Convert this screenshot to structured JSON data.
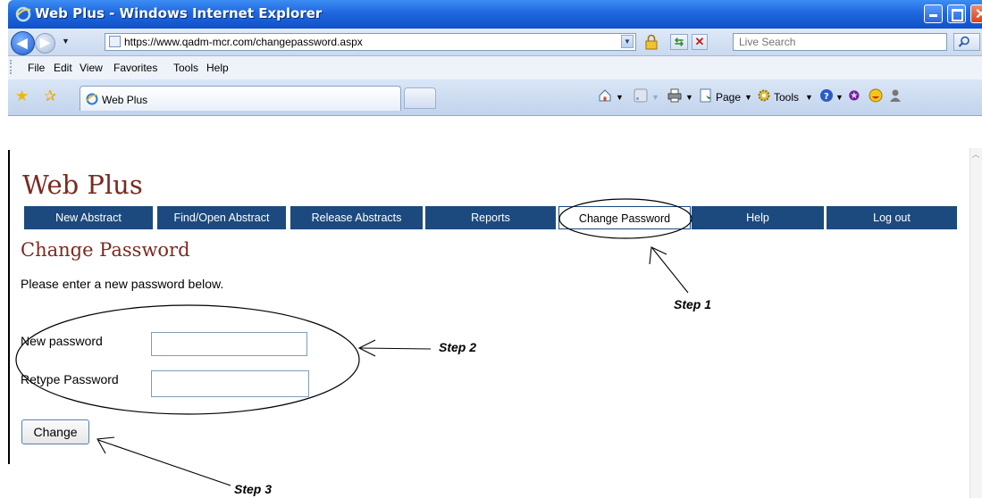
{
  "window": {
    "title": "Web Plus - Windows Internet Explorer"
  },
  "address_bar": {
    "url": "https://www.qadm-mcr.com/changepassword.aspx",
    "search_placeholder": "Live Search"
  },
  "menu": {
    "items": [
      "File",
      "Edit",
      "View",
      "Favorites",
      "Tools",
      "Help"
    ]
  },
  "tabs": {
    "active_label": "Web Plus"
  },
  "command_bar": {
    "page_label": "Page",
    "tools_label": "Tools"
  },
  "page": {
    "logo": "Web Plus",
    "nav": [
      {
        "label": "New Abstract",
        "selected": false
      },
      {
        "label": "Find/Open Abstract",
        "selected": false
      },
      {
        "label": "Release Abstracts",
        "selected": false
      },
      {
        "label": "Reports",
        "selected": false
      },
      {
        "label": "Change Password",
        "selected": true
      },
      {
        "label": "Help",
        "selected": false
      },
      {
        "label": "Log out",
        "selected": false
      }
    ],
    "heading": "Change Password",
    "intro": "Please enter a new password below.",
    "form": {
      "new_password_label": "New password",
      "new_password_value": "",
      "retype_password_label": "Retype Password",
      "retype_password_value": "",
      "submit_label": "Change"
    }
  },
  "annotations": {
    "step1": "Step 1",
    "step2": "Step 2",
    "step3": "Step 3"
  },
  "colors": {
    "nav_background": "#1c4a7e",
    "brand_text": "#7b2a20",
    "titlebar": "#1f67de"
  }
}
